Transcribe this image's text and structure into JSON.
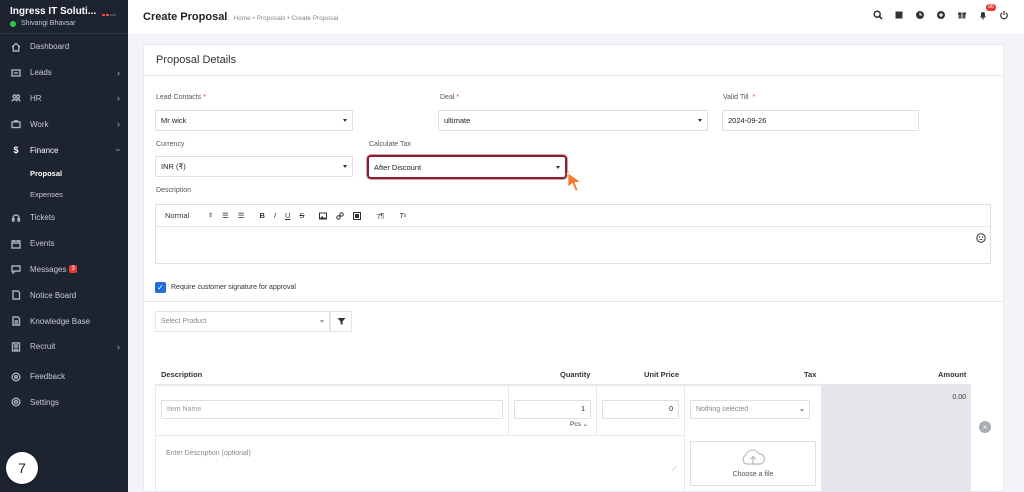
{
  "sidebar": {
    "company": "Ingress IT Soluti...",
    "user": "Shivangi Bhavsar",
    "items": [
      {
        "label": "Dashboard",
        "icon": "home-icon"
      },
      {
        "label": "Leads",
        "icon": "leads-icon"
      },
      {
        "label": "HR",
        "icon": "people-icon"
      },
      {
        "label": "Work",
        "icon": "briefcase-icon"
      },
      {
        "label": "Finance",
        "icon": "dollar-icon"
      },
      {
        "label": "Tickets",
        "icon": "headset-icon"
      },
      {
        "label": "Events",
        "icon": "calendar-icon"
      },
      {
        "label": "Messages",
        "icon": "message-icon",
        "badge": "3"
      },
      {
        "label": "Notice Board",
        "icon": "notice-icon"
      },
      {
        "label": "Knowledge Base",
        "icon": "book-icon"
      },
      {
        "label": "Recruit",
        "icon": "recruit-icon"
      },
      {
        "label": "Feedback",
        "icon": "feedback-icon"
      },
      {
        "label": "Settings",
        "icon": "gear-icon"
      }
    ],
    "finance_sub": [
      "Proposal",
      "Expenses"
    ],
    "step": "7"
  },
  "topbar": {
    "title": "Create Proposal",
    "breadcrumb": "Home • Proposals • Create Proposal",
    "notification_count": "96"
  },
  "form": {
    "heading": "Proposal Details",
    "lead_contacts_label": "Lead Contacts",
    "lead_contacts_value": "Mr wick",
    "deal_label": "Deal",
    "deal_value": "ultimate",
    "valid_till_label": "Valid Till",
    "valid_till_value": "2024-09-26",
    "currency_label": "Currency",
    "currency_value": "INR (₹)",
    "calc_tax_label": "Calculate Tax",
    "calc_tax_value": "After Discount",
    "description_label": "Description",
    "editor_format": "Normal",
    "signature_label": "Require customer signature for approval",
    "select_product_placeholder": "Select Product"
  },
  "items_table": {
    "headers": {
      "description": "Description",
      "quantity": "Quantity",
      "unit_price": "Unit Price",
      "tax": "Tax",
      "amount": "Amount"
    },
    "row": {
      "item_name_placeholder": "Item Name",
      "quantity": "1",
      "unit": "Pcs",
      "unit_price": "0",
      "tax_placeholder": "Nothing selected",
      "amount": "0.00",
      "description_placeholder": "Enter Description (optional)",
      "file_label": "Choose a file"
    }
  },
  "colors": {
    "sidebar_bg": "#1d2330",
    "highlight_border": "#8b1d2c",
    "pointer": "#f07c2a",
    "checkbox": "#1e6fd9"
  }
}
